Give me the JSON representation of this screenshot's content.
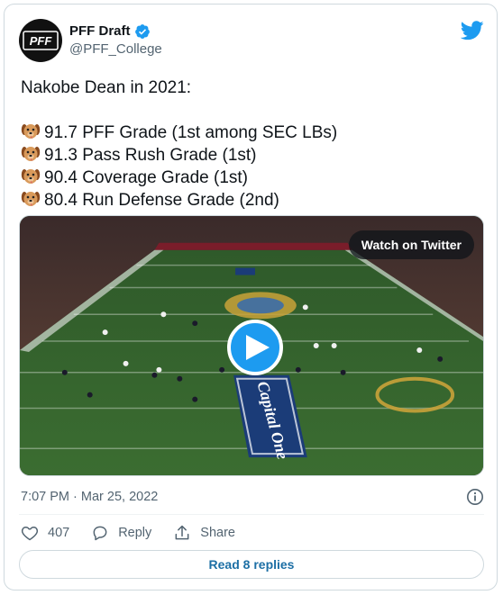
{
  "author": {
    "display_name": "PFF Draft",
    "handle": "@PFF_College",
    "avatar_text": "PFF"
  },
  "tweet": {
    "intro": "Nakobe Dean in 2021:",
    "stats": [
      {
        "emoji": "dog-face-emoji",
        "text": "91.7 PFF Grade (1st among SEC LBs)"
      },
      {
        "emoji": "dog-face-emoji",
        "text": "91.3 Pass Rush Grade (1st)"
      },
      {
        "emoji": "dog-face-emoji",
        "text": "90.4 Coverage Grade (1st)"
      },
      {
        "emoji": "dog-face-emoji",
        "text": "80.4 Run Defense Grade (2nd)"
      }
    ]
  },
  "media": {
    "watch_label": "Watch on Twitter",
    "endzone_brand": "Capital One"
  },
  "meta": {
    "timestamp": "7:07 PM · Mar 25, 2022"
  },
  "actions": {
    "like_count": "407",
    "reply_label": "Reply",
    "share_label": "Share"
  },
  "footer": {
    "read_replies_label": "Read 8 replies"
  },
  "colors": {
    "brand_blue": "#1d9bf0",
    "link_blue": "#1d6fa5",
    "text_primary": "#0f1419",
    "text_secondary": "#536471"
  }
}
